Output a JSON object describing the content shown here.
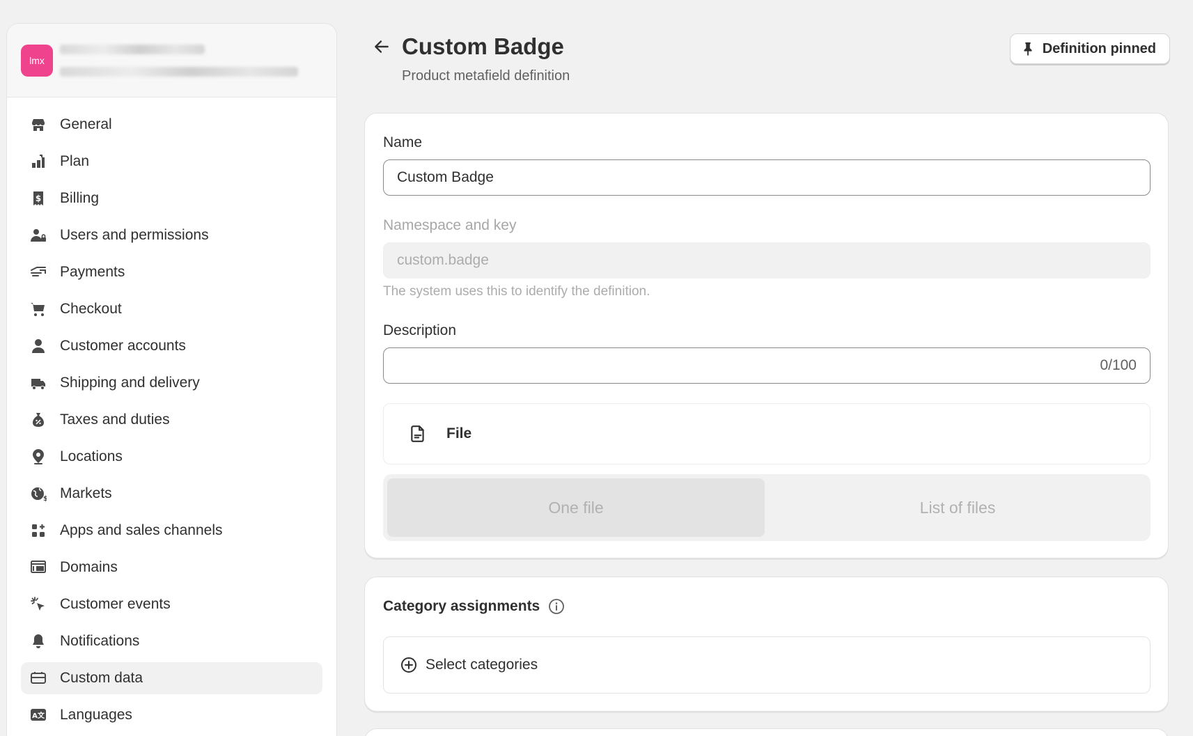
{
  "store": {
    "avatar_text": "lmx"
  },
  "sidebar": {
    "items": [
      {
        "label": "General",
        "icon": "store-icon"
      },
      {
        "label": "Plan",
        "icon": "plan-icon"
      },
      {
        "label": "Billing",
        "icon": "billing-icon"
      },
      {
        "label": "Users and permissions",
        "icon": "users-icon"
      },
      {
        "label": "Payments",
        "icon": "payments-icon"
      },
      {
        "label": "Checkout",
        "icon": "cart-icon"
      },
      {
        "label": "Customer accounts",
        "icon": "person-icon"
      },
      {
        "label": "Shipping and delivery",
        "icon": "truck-icon"
      },
      {
        "label": "Taxes and duties",
        "icon": "tax-icon"
      },
      {
        "label": "Locations",
        "icon": "location-pin-icon"
      },
      {
        "label": "Markets",
        "icon": "globe-icon"
      },
      {
        "label": "Apps and sales channels",
        "icon": "apps-icon"
      },
      {
        "label": "Domains",
        "icon": "domains-icon"
      },
      {
        "label": "Customer events",
        "icon": "cursor-click-icon"
      },
      {
        "label": "Notifications",
        "icon": "bell-icon"
      },
      {
        "label": "Custom data",
        "icon": "custom-data-icon"
      },
      {
        "label": "Languages",
        "icon": "language-icon"
      }
    ],
    "active_index": 15
  },
  "header": {
    "title": "Custom Badge",
    "subtitle": "Product metafield definition",
    "pin_label": "Definition pinned"
  },
  "form": {
    "name_label": "Name",
    "name_value": "Custom Badge",
    "namespace_label": "Namespace and key",
    "namespace_value": "custom.badge",
    "namespace_help": "The system uses this to identify the definition.",
    "description_label": "Description",
    "description_value": "",
    "description_counter": "0/100",
    "type_label": "File",
    "segments": [
      "One file",
      "List of files"
    ],
    "selected_segment": 0
  },
  "categories": {
    "title": "Category assignments",
    "select_label": "Select categories"
  }
}
